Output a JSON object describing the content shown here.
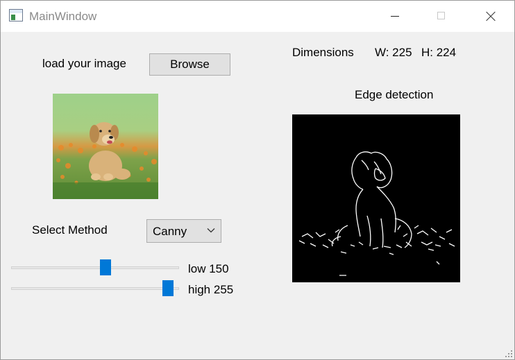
{
  "window": {
    "title": "MainWindow"
  },
  "load": {
    "label": "load your image",
    "browse_label": "Browse"
  },
  "dimensions": {
    "label": "Dimensions",
    "width_text": "W: 225",
    "height_text": "H: 224"
  },
  "edge": {
    "title": "Edge detection"
  },
  "method": {
    "label": "Select Method",
    "selected": "Canny"
  },
  "sliders": {
    "low": {
      "label": "low 150",
      "value": 150,
      "max": 255
    },
    "high": {
      "label": "high 255",
      "value": 255,
      "max": 255
    }
  },
  "colors": {
    "accent": "#0078d7",
    "button_bg": "#e1e1e1",
    "window_bg": "#f0f0f0"
  },
  "icons": [
    "app-icon",
    "minimize-icon",
    "maximize-icon",
    "close-icon",
    "chevron-down-icon",
    "resize-grip-icon"
  ]
}
